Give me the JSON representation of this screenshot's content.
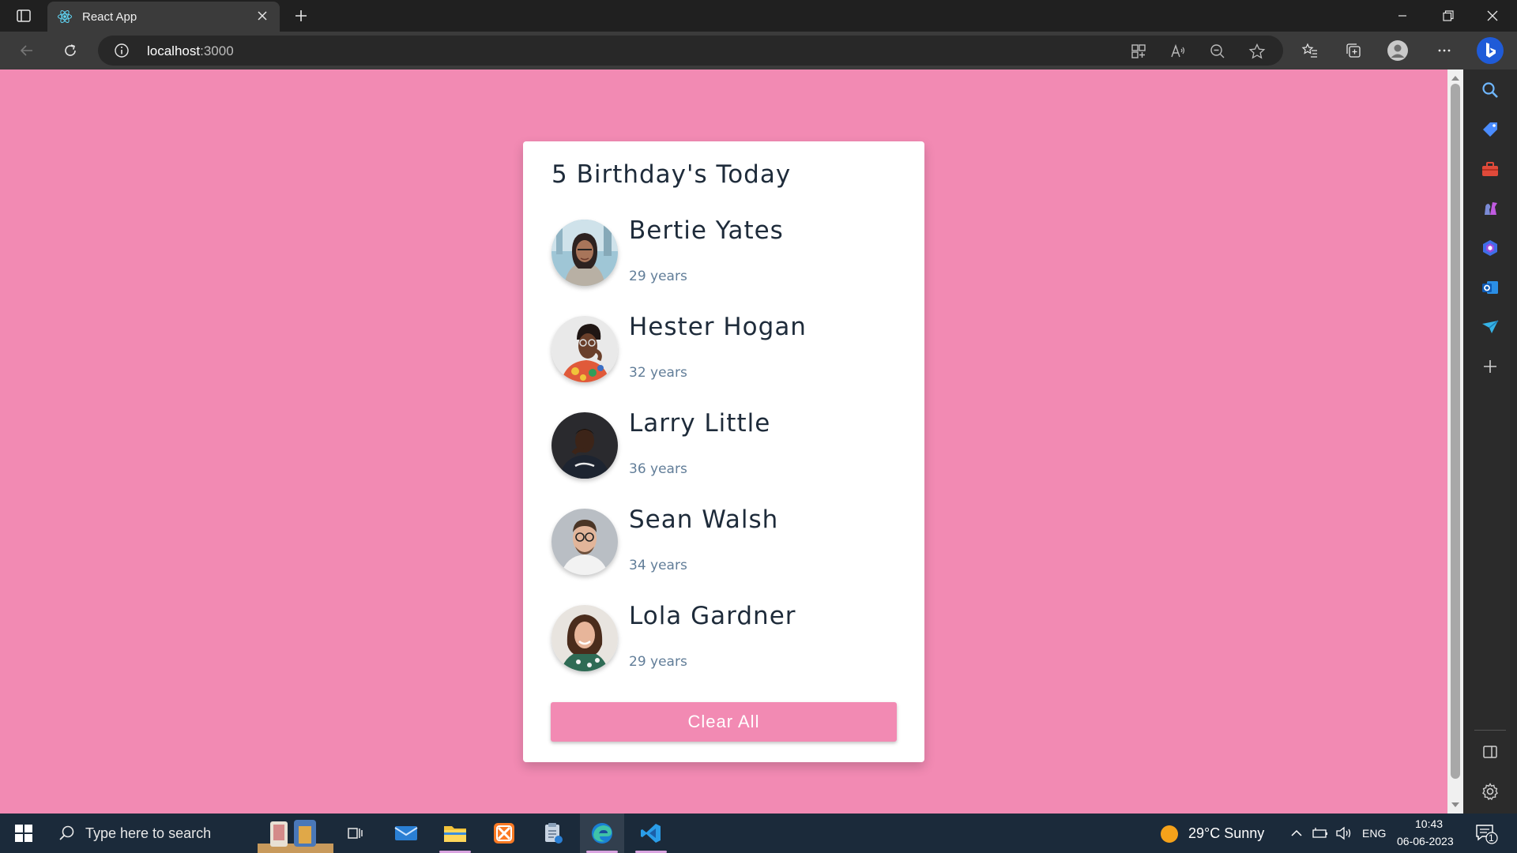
{
  "browser": {
    "tab_title": "React App",
    "url_host": "localhost",
    "url_port": ":3000"
  },
  "page": {
    "heading": "5 Birthday's Today",
    "people": [
      {
        "name": "Bertie Yates",
        "age": "29 years"
      },
      {
        "name": "Hester Hogan",
        "age": "32 years"
      },
      {
        "name": "Larry Little",
        "age": "36 years"
      },
      {
        "name": "Sean Walsh",
        "age": "34 years"
      },
      {
        "name": "Lola Gardner",
        "age": "29 years"
      }
    ],
    "clear_label": "Clear All"
  },
  "taskbar": {
    "search_placeholder": "Type here to search",
    "weather": "29°C  Sunny",
    "language": "ENG",
    "time": "10:43",
    "date": "06-06-2023",
    "notification_count": "1"
  },
  "colors": {
    "page_background": "#f28ab3",
    "card_background": "#ffffff",
    "heading_text": "#1e2b3a",
    "age_text": "#617d98"
  }
}
